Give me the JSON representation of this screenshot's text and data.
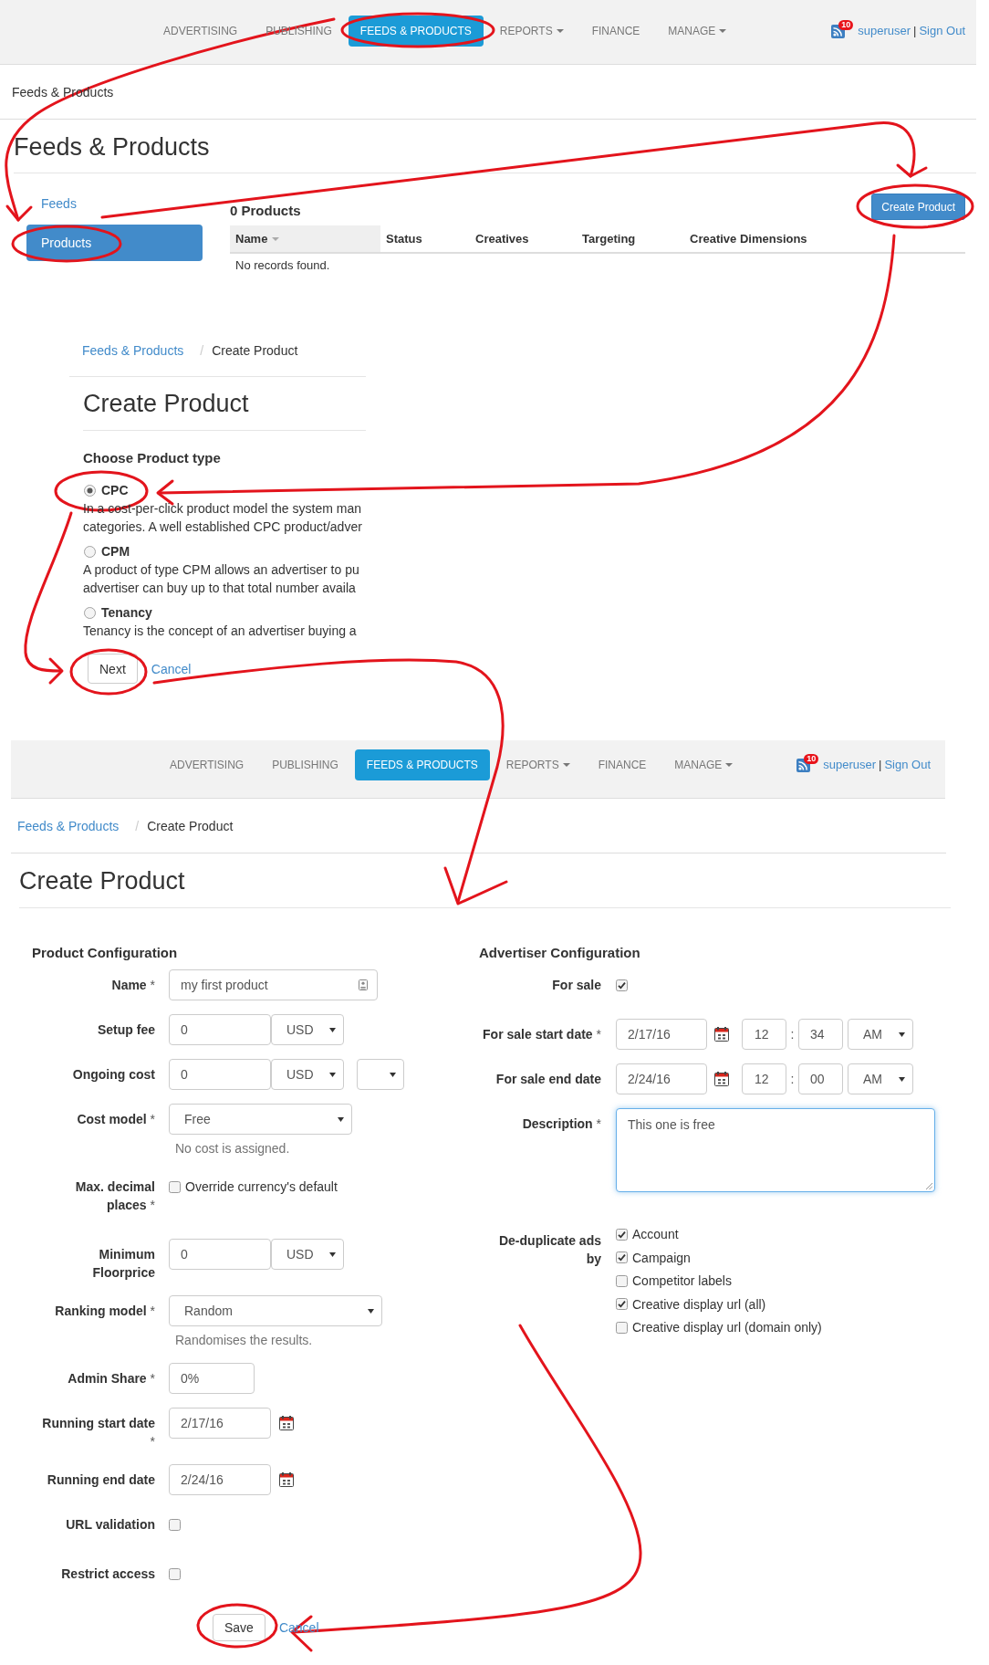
{
  "feeds_page": {
    "nav": {
      "items": [
        {
          "label": "ADVERTISING",
          "selected": false,
          "dropdown": false
        },
        {
          "label": "PUBLISHING",
          "selected": false,
          "dropdown": false
        },
        {
          "label": "FEEDS & PRODUCTS",
          "selected": true,
          "dropdown": false
        },
        {
          "label": "REPORTS",
          "selected": false,
          "dropdown": true
        },
        {
          "label": "FINANCE",
          "selected": false,
          "dropdown": false
        },
        {
          "label": "MANAGE",
          "selected": false,
          "dropdown": true
        }
      ],
      "badge": "10",
      "user": "superuser",
      "separator": "|",
      "sign_out": "Sign Out"
    },
    "breadcrumb": {
      "items": [
        {
          "label": "Feeds & Products",
          "kind": "current"
        }
      ]
    },
    "title": "Feeds & Products",
    "sidebar": {
      "items": [
        {
          "label": "Feeds",
          "selected": false
        },
        {
          "label": "Products",
          "selected": true
        }
      ]
    },
    "count": "0 Products",
    "create_button": "Create Product",
    "table": {
      "columns": [
        {
          "label": "Name",
          "sorted": true
        },
        {
          "label": "Status",
          "sorted": false
        },
        {
          "label": "Creatives",
          "sorted": false
        },
        {
          "label": "Targeting",
          "sorted": false
        },
        {
          "label": "Creative Dimensions",
          "sorted": false
        }
      ],
      "empty_text": "No records found."
    }
  },
  "type_dialog": {
    "breadcrumb": {
      "items": [
        {
          "label": "Feeds & Products",
          "kind": "link"
        },
        {
          "label": "Create Product",
          "kind": "current"
        }
      ],
      "separator": "/"
    },
    "title": "Create Product",
    "heading": "Choose Product type",
    "options": [
      {
        "label": "CPC",
        "selected": true,
        "description": [
          "In a cost-per-click product model the system man",
          "categories. A well established CPC product/adver"
        ]
      },
      {
        "label": "CPM",
        "selected": false,
        "description": [
          "A product of type CPM allows an advertiser to pu",
          "advertiser can buy up to that total number availa"
        ]
      },
      {
        "label": "Tenancy",
        "selected": false,
        "description": [
          "Tenancy is the concept of an advertiser buying a"
        ]
      }
    ],
    "next_button": "Next",
    "cancel_link": "Cancel"
  },
  "create_page": {
    "nav": {
      "items": [
        {
          "label": "ADVERTISING",
          "selected": false,
          "dropdown": false
        },
        {
          "label": "PUBLISHING",
          "selected": false,
          "dropdown": false
        },
        {
          "label": "FEEDS & PRODUCTS",
          "selected": true,
          "dropdown": false
        },
        {
          "label": "REPORTS",
          "selected": false,
          "dropdown": true
        },
        {
          "label": "FINANCE",
          "selected": false,
          "dropdown": false
        },
        {
          "label": "MANAGE",
          "selected": false,
          "dropdown": true
        }
      ],
      "badge": "10",
      "user": "superuser",
      "separator": "|",
      "sign_out": "Sign Out"
    },
    "breadcrumb": {
      "items": [
        {
          "label": "Feeds & Products",
          "kind": "link"
        },
        {
          "label": "Create Product",
          "kind": "current"
        }
      ],
      "separator": "/"
    },
    "title": "Create Product",
    "product_config": {
      "title": "Product Configuration",
      "fields": [
        {
          "kind": "text",
          "label": "Name",
          "required_mark": "*",
          "value": "my first product"
        },
        {
          "kind": "money",
          "label": "Setup fee",
          "value": "0",
          "currency": "USD"
        },
        {
          "kind": "money_period",
          "label": "Ongoing cost",
          "value": "0",
          "currency": "USD"
        },
        {
          "kind": "select",
          "label": "Cost model",
          "required_mark": "*",
          "value": "Free",
          "help": "No cost is assigned."
        },
        {
          "kind": "checkbox",
          "label": "Max. decimal places",
          "required_mark": "*",
          "checked": false,
          "text": "Override currency's default"
        },
        {
          "kind": "money",
          "label": "Minimum Floorprice",
          "value": "0",
          "currency": "USD"
        },
        {
          "kind": "select",
          "label": "Ranking model",
          "required_mark": "*",
          "value": "Random",
          "help": "Randomises the results."
        },
        {
          "kind": "short_text",
          "label": "Admin Share",
          "required_mark": "*",
          "value": "0%"
        },
        {
          "kind": "date",
          "label": "Running start date",
          "required_mark": "*",
          "value": "2/17/16"
        },
        {
          "kind": "date",
          "label": "Running end date",
          "value": "2/24/16"
        },
        {
          "kind": "checkbox",
          "label": "URL validation",
          "checked": false
        },
        {
          "kind": "checkbox",
          "label": "Restrict access",
          "checked": false
        }
      ]
    },
    "advertiser_config": {
      "title": "Advertiser Configuration",
      "fields": [
        {
          "kind": "checkbox",
          "label": "For sale",
          "checked": true
        },
        {
          "kind": "datetime",
          "label": "For sale start date",
          "required_mark": "*",
          "date": "2/17/16",
          "hour": "12",
          "separator": ":",
          "minute": "34",
          "period": "AM"
        },
        {
          "kind": "datetime",
          "label": "For sale end date",
          "date": "2/24/16",
          "hour": "12",
          "separator": ":",
          "minute": "00",
          "period": "AM"
        },
        {
          "kind": "textarea",
          "label": "Description",
          "required_mark": "*",
          "value": "This one is free",
          "focused": true
        },
        {
          "kind": "checkbox_group",
          "label": "De-duplicate ads by",
          "options": [
            {
              "label": "Account",
              "checked": true
            },
            {
              "label": "Campaign",
              "checked": true
            },
            {
              "label": "Competitor labels",
              "checked": false
            },
            {
              "label": "Creative display url (all)",
              "checked": true
            },
            {
              "label": "Creative display url (domain only)",
              "checked": false
            }
          ]
        }
      ]
    },
    "save_button": "Save",
    "cancel_link": "Cancel"
  }
}
